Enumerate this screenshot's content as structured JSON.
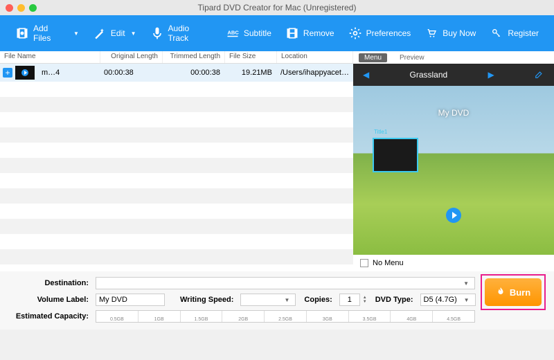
{
  "window": {
    "title": "Tipard DVD Creator for Mac (Unregistered)"
  },
  "toolbar": {
    "add_files": "Add Files",
    "edit": "Edit",
    "audio_track": "Audio Track",
    "subtitle": "Subtitle",
    "remove": "Remove",
    "preferences": "Preferences",
    "buy_now": "Buy Now",
    "register": "Register"
  },
  "columns": {
    "file_name": "File Name",
    "original_length": "Original Length",
    "trimmed_length": "Trimmed Length",
    "file_size": "File Size",
    "location": "Location"
  },
  "files": [
    {
      "name": "m…4",
      "original": "00:00:38",
      "trimmed": "00:00:38",
      "size": "19.21MB",
      "location": "/Users/ihappyacet…"
    }
  ],
  "preview": {
    "tab_menu": "Menu",
    "tab_preview": "Preview",
    "theme_name": "Grassland",
    "disc_title": "My DVD",
    "thumb_label": "Title1",
    "no_menu": "No Menu"
  },
  "form": {
    "destination_label": "Destination:",
    "destination_value": "",
    "volume_label_label": "Volume Label:",
    "volume_label_value": "My DVD",
    "writing_speed_label": "Writing Speed:",
    "writing_speed_value": "",
    "copies_label": "Copies:",
    "copies_value": "1",
    "dvd_type_label": "DVD Type:",
    "dvd_type_value": "D5 (4.7G)",
    "estimated_capacity_label": "Estimated Capacity:",
    "burn": "Burn"
  },
  "capacity_ticks": [
    "0.5GB",
    "1GB",
    "1.5GB",
    "2GB",
    "2.5GB",
    "3GB",
    "3.5GB",
    "4GB",
    "4.5GB"
  ]
}
